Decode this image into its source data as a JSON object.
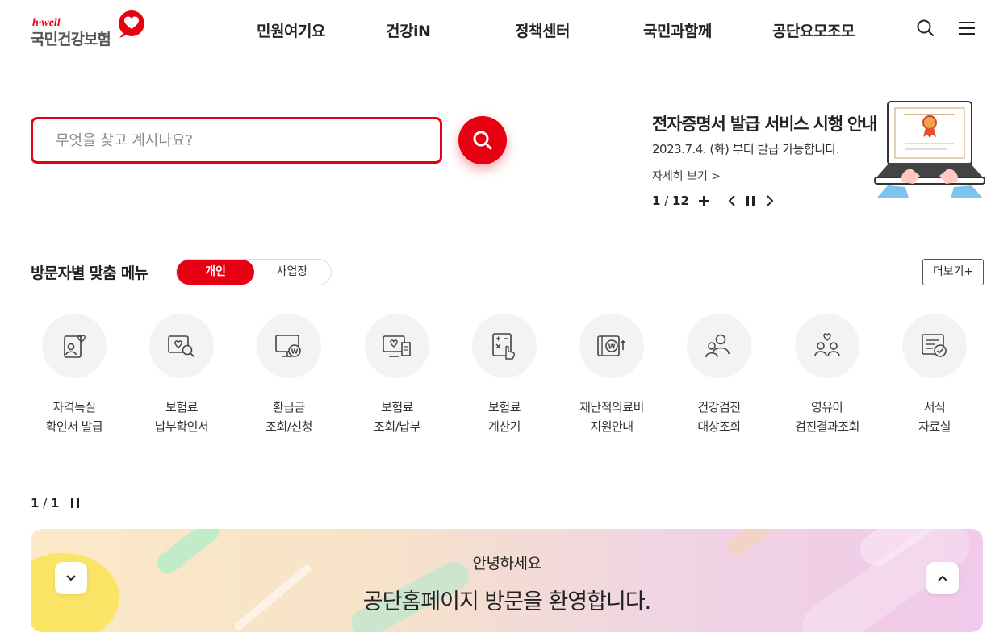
{
  "colors": {
    "brand": "#e60012",
    "text": "#222222",
    "icon_bg": "#f3f3f3"
  },
  "logo": {
    "tagline": "h·well",
    "name": "국민건강보험"
  },
  "nav": [
    "민원여기요",
    "건강iN",
    "정책센터",
    "국민과함께",
    "공단요모조모"
  ],
  "header_icons": [
    "search-icon",
    "hamburger-menu-icon"
  ],
  "search": {
    "placeholder": "무엇을 찾고 계시나요?",
    "value": ""
  },
  "notice": {
    "title": "전자증명서 발급 서비스 시행 안내",
    "date": "2023.7.4. (화) 부터 발급 가능합니다.",
    "more": "자세히 보기 >",
    "current": "1",
    "total": "12"
  },
  "visitor_menu": {
    "title": "방문자별 맞춤 메뉴",
    "tab_on": "개인",
    "tab_off": "사업장",
    "more": "더보기+",
    "items": [
      {
        "line1": "자격득실",
        "line2": "확인서 발급",
        "icon": "id-card-heart-icon"
      },
      {
        "line1": "보험료",
        "line2": "납부확인서",
        "icon": "card-search-icon"
      },
      {
        "line1": "환급금",
        "line2": "조회/신청",
        "icon": "monitor-won-icon"
      },
      {
        "line1": "보험료",
        "line2": "조회/납부",
        "icon": "monitor-receipt-icon"
      },
      {
        "line1": "보험료",
        "line2": "계산기",
        "icon": "calculator-hand-icon"
      },
      {
        "line1": "재난적의료비",
        "line2": "지원안내",
        "icon": "won-support-icon"
      },
      {
        "line1": "건강검진",
        "line2": "대상조회",
        "icon": "people-search-icon"
      },
      {
        "line1": "영유아",
        "line2": "검진결과조회",
        "icon": "family-heart-icon"
      },
      {
        "line1": "서식",
        "line2": "자료실",
        "icon": "document-check-icon"
      }
    ],
    "page_current": "1",
    "page_total": "1"
  },
  "banner": {
    "hello": "안녕하세요",
    "main": "공단홈페이지 방문을 환영합니다."
  }
}
